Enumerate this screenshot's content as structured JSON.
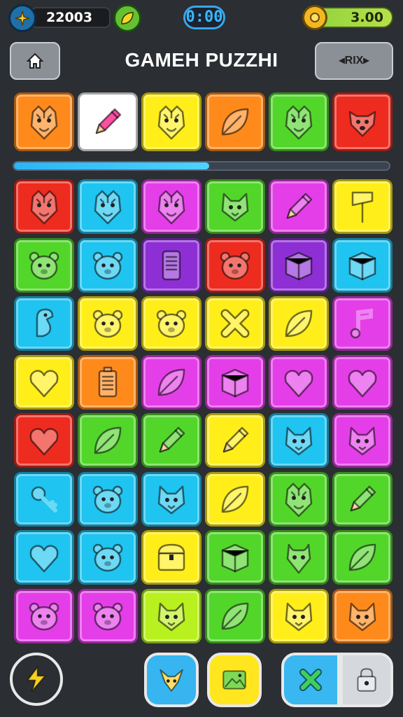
{
  "header": {
    "coins": "22003",
    "timer": "0:00",
    "gold": "3.00",
    "title": "GAMEH PUZZHI",
    "right_button": "RIX"
  },
  "progress": {
    "value": 0.52
  },
  "colors": {
    "orange": "#ff8a1c",
    "white": "#ffffff",
    "yellow": "#ffee1a",
    "green": "#52d62a",
    "red": "#ee2b1f",
    "cyan": "#1fc4f0",
    "magenta": "#e43ee8",
    "purple": "#8e2fd6",
    "lime": "#b9f01f"
  },
  "top_row": [
    {
      "color": "orange",
      "icon": "tiger-icon"
    },
    {
      "color": "white",
      "icon": "pencil-icon"
    },
    {
      "color": "yellow",
      "icon": "tiger-icon"
    },
    {
      "color": "orange",
      "icon": "leaf-icon"
    },
    {
      "color": "green",
      "icon": "tiger-icon"
    },
    {
      "color": "red",
      "icon": "dog-icon"
    }
  ],
  "grid": [
    [
      {
        "color": "red",
        "icon": "tiger-icon"
      },
      {
        "color": "cyan",
        "icon": "tiger-icon"
      },
      {
        "color": "magenta",
        "icon": "tiger-icon"
      },
      {
        "color": "green",
        "icon": "cat-icon"
      },
      {
        "color": "magenta",
        "icon": "pencil-icon"
      },
      {
        "color": "yellow",
        "icon": "axe-icon"
      }
    ],
    [
      {
        "color": "green",
        "icon": "bear-icon"
      },
      {
        "color": "cyan",
        "icon": "bear-icon"
      },
      {
        "color": "purple",
        "icon": "phone-icon"
      },
      {
        "color": "red",
        "icon": "bear-icon"
      },
      {
        "color": "purple",
        "icon": "box-icon"
      },
      {
        "color": "cyan",
        "icon": "box-icon"
      }
    ],
    [
      {
        "color": "cyan",
        "icon": "seahorse-icon"
      },
      {
        "color": "yellow",
        "icon": "bear-icon"
      },
      {
        "color": "yellow",
        "icon": "bear-icon"
      },
      {
        "color": "yellow",
        "icon": "cross-icon"
      },
      {
        "color": "yellow",
        "icon": "leaf-icon"
      },
      {
        "color": "magenta",
        "icon": "note-icon"
      }
    ],
    [
      {
        "color": "yellow",
        "icon": "heart-icon"
      },
      {
        "color": "orange",
        "icon": "battery-icon"
      },
      {
        "color": "magenta",
        "icon": "leaf-icon"
      },
      {
        "color": "magenta",
        "icon": "box-icon"
      },
      {
        "color": "magenta",
        "icon": "heart-icon"
      },
      {
        "color": "magenta",
        "icon": "heart-icon"
      }
    ],
    [
      {
        "color": "red",
        "icon": "heart-icon"
      },
      {
        "color": "green",
        "icon": "leaf-icon"
      },
      {
        "color": "green",
        "icon": "pencil-icon"
      },
      {
        "color": "yellow",
        "icon": "pencil-icon"
      },
      {
        "color": "cyan",
        "icon": "cat-icon"
      },
      {
        "color": "magenta",
        "icon": "cat-icon"
      }
    ],
    [
      {
        "color": "cyan",
        "icon": "key-icon"
      },
      {
        "color": "cyan",
        "icon": "bear-icon"
      },
      {
        "color": "cyan",
        "icon": "cat-icon"
      },
      {
        "color": "yellow",
        "icon": "leaf-icon"
      },
      {
        "color": "green",
        "icon": "tiger-icon"
      },
      {
        "color": "green",
        "icon": "pencil-icon"
      }
    ],
    [
      {
        "color": "cyan",
        "icon": "heart-icon"
      },
      {
        "color": "cyan",
        "icon": "bear-icon"
      },
      {
        "color": "yellow",
        "icon": "chest-icon"
      },
      {
        "color": "green",
        "icon": "box-icon"
      },
      {
        "color": "green",
        "icon": "goat-icon"
      },
      {
        "color": "green",
        "icon": "leaf-icon"
      }
    ],
    [
      {
        "color": "magenta",
        "icon": "bear-icon"
      },
      {
        "color": "magenta",
        "icon": "bear-icon"
      },
      {
        "color": "lime",
        "icon": "cat-icon"
      },
      {
        "color": "green",
        "icon": "leaf-icon"
      },
      {
        "color": "yellow",
        "icon": "cat-icon"
      },
      {
        "color": "orange",
        "icon": "cat-icon"
      }
    ]
  ],
  "bottom_bar": [
    {
      "name": "lightning-button",
      "icon": "lightning-icon"
    },
    {
      "name": "fox-button",
      "icon": "fox-icon"
    },
    {
      "name": "picture-button",
      "icon": "picture-icon"
    },
    {
      "name": "shuffle-button",
      "icon": "cross-icon"
    },
    {
      "name": "lock-button",
      "icon": "lock-icon"
    }
  ]
}
